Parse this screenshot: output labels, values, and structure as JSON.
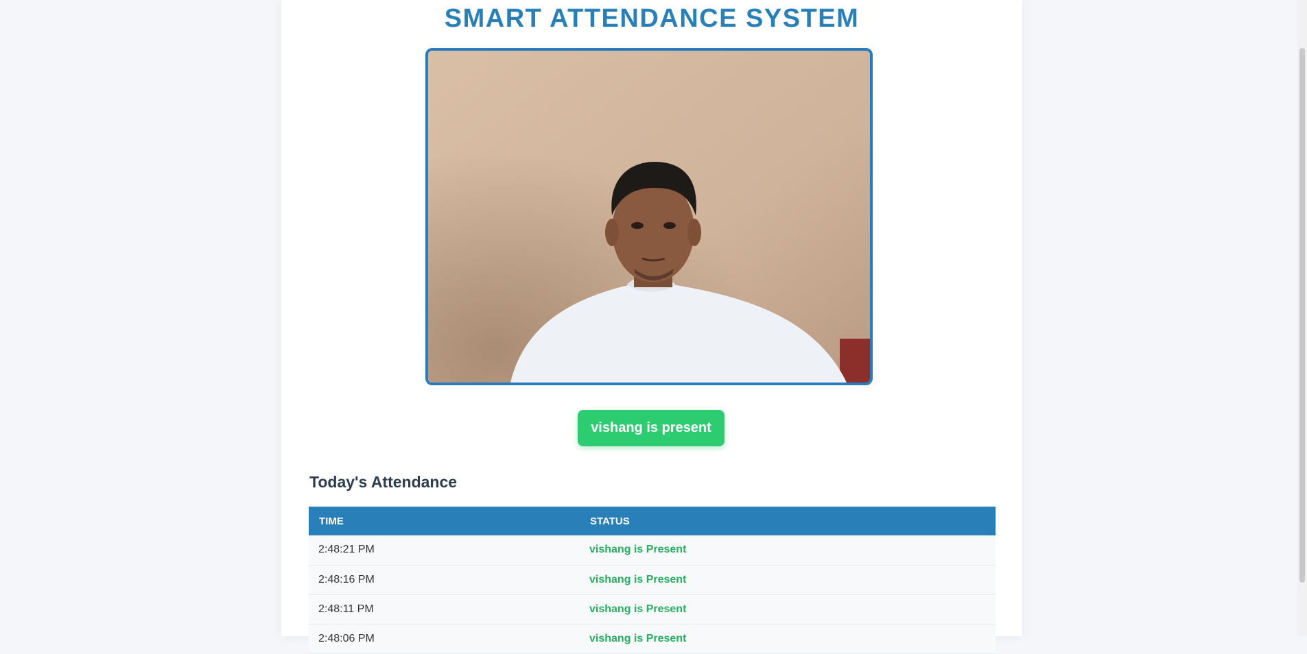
{
  "page": {
    "title": "SMART ATTENDANCE SYSTEM"
  },
  "video": {
    "label": "webcam-feed"
  },
  "status": {
    "message": "vishang is present",
    "color": "#2ecc71"
  },
  "attendance": {
    "heading": "Today's Attendance",
    "columns": [
      "TIME",
      "STATUS"
    ],
    "rows": [
      {
        "time": "2:48:21 PM",
        "status": "vishang is Present"
      },
      {
        "time": "2:48:16 PM",
        "status": "vishang is Present"
      },
      {
        "time": "2:48:11 PM",
        "status": "vishang is Present"
      },
      {
        "time": "2:48:06 PM",
        "status": "vishang is Present"
      }
    ]
  },
  "colors": {
    "accent": "#2980b9",
    "present": "#27ae60"
  }
}
